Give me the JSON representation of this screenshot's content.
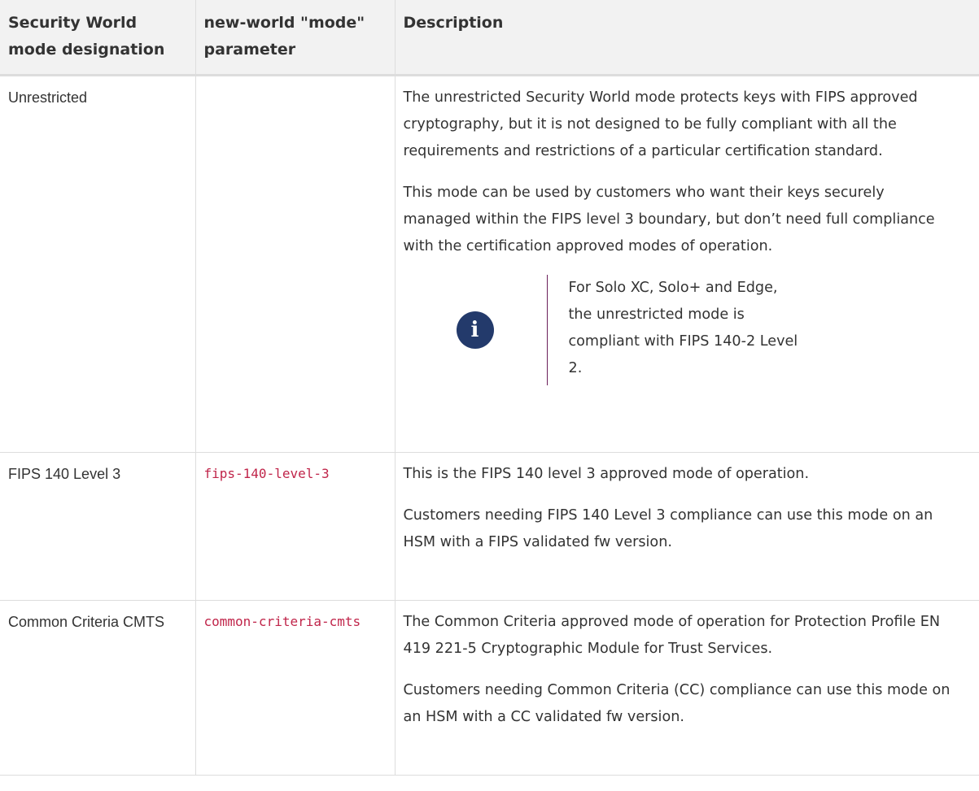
{
  "table": {
    "headers": [
      "Security World mode designation",
      "new-world \"mode\" parameter",
      "Description"
    ],
    "rows": [
      {
        "designation": "Unrestricted",
        "parameter": "",
        "paragraphs": [
          "The unrestricted Security World mode protects keys with FIPS approved cryptography, but it is not designed to be fully compli­ant with all the requirements and restrictions of a particular certifi­cation standard.",
          "This mode can be used by customers who want their keys securely managed within the FIPS level 3 boundary, but don’t need full compliance with the certification approved modes of operation."
        ],
        "note": {
          "icon": "info-icon",
          "glyph": "i",
          "text": "For Solo XC, Solo+ and Edge, the unre­stricted mode is compliant with FIPS 140-2 Level 2."
        }
      },
      {
        "designation": "FIPS 140 Level 3",
        "parameter": "fips-140-level-3",
        "paragraphs": [
          "This is the FIPS 140 level 3 approved mode of operation.",
          "Customers needing FIPS 140 Level 3 compliance can use this mode on an HSM with a FIPS validated fw version."
        ]
      },
      {
        "designation": "Common Criteria CMTS",
        "parameter": "common-criteria-cmts",
        "paragraphs": [
          "The Common Criteria approved mode of operation for Protection Profile EN 419 221-5 Cryptographic Module for Trust Services.",
          "Customers needing Common Criteria (CC) compliance can use this mode on an HSM with a CC validated fw version."
        ]
      }
    ]
  },
  "colors": {
    "header_bg": "#f2f2f2",
    "code_text": "#c0254a",
    "note_icon_bg": "#233a6b",
    "note_bar": "#6b1f5a"
  }
}
